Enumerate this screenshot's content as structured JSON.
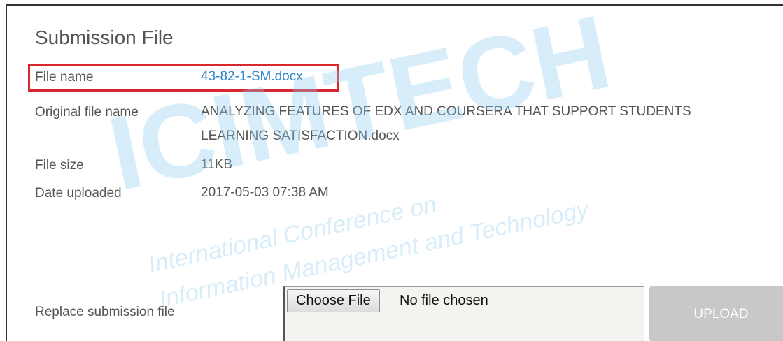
{
  "panel": {
    "title": "Submission File"
  },
  "details": {
    "file_name_label": "File name",
    "file_name_value": "43-82-1-SM.docx",
    "original_name_label": "Original file name",
    "original_name_line1": "ANALYZING FEATURES OF EDX AND COURSERA THAT SUPPORT STUDENTS",
    "original_name_line2": "LEARNING SATISFACTION.docx",
    "file_size_label": "File size",
    "file_size_value": "11KB",
    "date_uploaded_label": "Date uploaded",
    "date_uploaded_value": "2017-05-03 07:38 AM"
  },
  "replace": {
    "label": "Replace submission file",
    "choose_button": "Choose File",
    "status": "No file chosen",
    "upload_button": "UPLOAD"
  },
  "watermark": {
    "logo_text": "ICIMTECH",
    "line1": "International Conference on",
    "line2": "Information Management and Technology"
  },
  "colors": {
    "link": "#2a86c8",
    "highlight": "#d7262e",
    "upload_disabled": "#c8c8c8",
    "watermark": "#bfe3f6"
  }
}
